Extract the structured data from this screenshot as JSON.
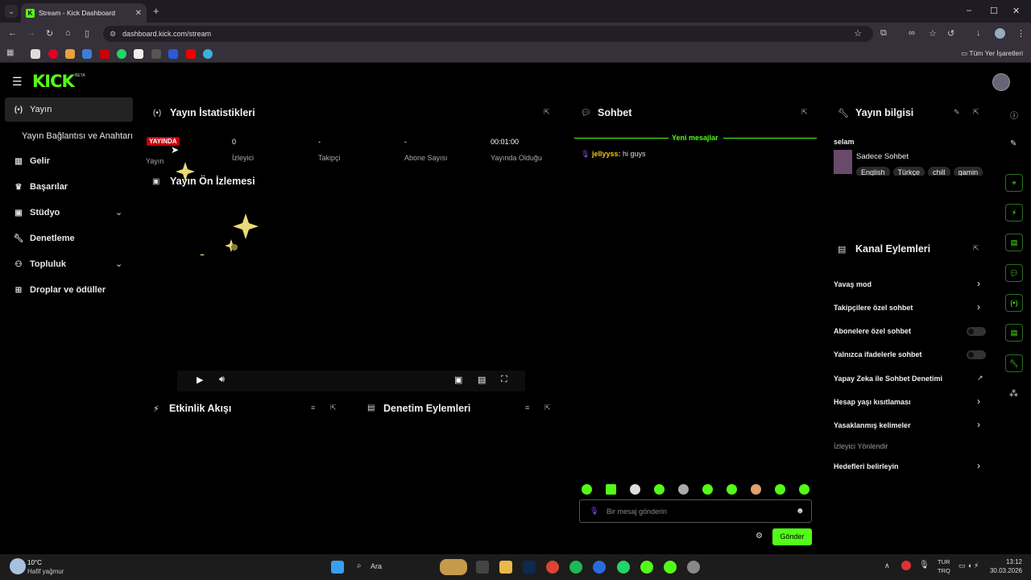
{
  "browser": {
    "tab_title": "Stream - Kick Dashboard",
    "tab_close": "✕",
    "new_tab": "+",
    "url": "dashboard.kick.com/stream",
    "all_bookmarks": "Tüm Yer İşaretleri"
  },
  "brand": {
    "logo": "KICK",
    "beta": "BETA"
  },
  "sidebar": {
    "items": [
      {
        "label": "Yayın"
      },
      {
        "label": "Yayın Bağlantısı ve Anahtarı"
      },
      {
        "label": "Gelir"
      },
      {
        "label": "Başarılar"
      },
      {
        "label": "Stüdyo"
      },
      {
        "label": "Denetleme"
      },
      {
        "label": "Topluluk"
      },
      {
        "label": "Droplar ve ödüller"
      }
    ]
  },
  "stats": {
    "title": "Yayın İstatistikleri",
    "live_badge": "YAYINDA",
    "stream_label": "Yayın",
    "viewers_value": "0",
    "viewers_label": "İzleyici",
    "followers_value": "-",
    "followers_label": "Takipçi",
    "subs_value": "-",
    "subs_label": "Abone Sayısı",
    "uptime_value": "00:01:00",
    "uptime_label": "Yayında Olduğu"
  },
  "preview": {
    "title": "Yayın Ön İzlemesi"
  },
  "activity": {
    "title": "Etkinlik Akışı"
  },
  "mod_actions": {
    "title": "Denetim Eylemleri"
  },
  "chat": {
    "title": "Sohbet",
    "new_messages": "Yeni mesajlar",
    "messages": [
      {
        "user": "jellyyss:",
        "text": "hi guys"
      }
    ],
    "input_placeholder": "Bir mesaj gönderin",
    "send_label": "Gönder"
  },
  "stream_info": {
    "title": "Yayın bilgisi",
    "stream_title": "selam",
    "chat_mode": "Sadece Sohbet",
    "tags": [
      "English",
      "Türkçe",
      "chill",
      "gamin"
    ]
  },
  "channel_actions": {
    "title": "Kanal Eylemleri",
    "slow_mode": "Yavaş mod",
    "followers_only": "Takipçilere özel sohbet",
    "subs_only": "Abonelere özel sohbet",
    "emotes_only": "Yalnızca ifadelerle sohbet",
    "ai_mod": "Yapay Zeka ile Sohbet Denetimi",
    "age_restrict": "Hesap yaşı kısıtlaması",
    "banned_words": "Yasaklanmış kelimeler",
    "viewer_redirect": "İzleyici Yönlendir",
    "set_goals": "Hedefleri belirleyin"
  },
  "taskbar": {
    "weather_temp": "10°C",
    "weather_desc": "Hafif yağmur",
    "search": "Ara",
    "lang_top": "TUR",
    "lang_bottom": "TRQ",
    "time": "13:12",
    "date": "30.03.2026"
  },
  "colors": {
    "accent": "#53fc18",
    "live": "#c8000a",
    "chat_user": "#f5c518"
  }
}
